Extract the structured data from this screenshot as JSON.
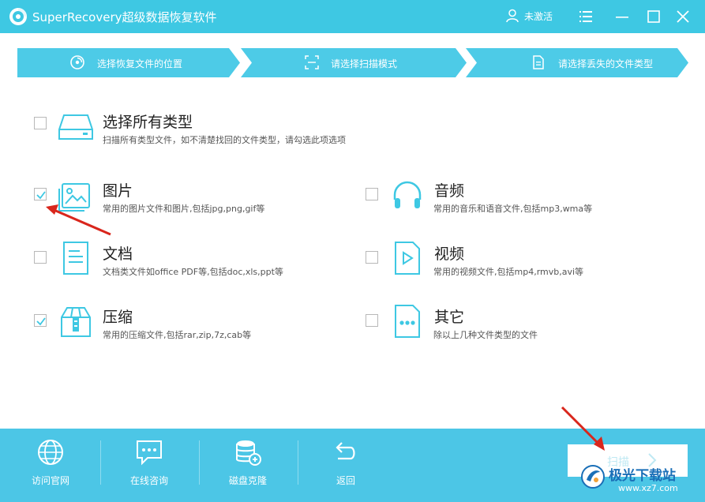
{
  "app": {
    "title": "SuperRecovery超级数据恢复软件",
    "user_label": "未激活",
    "accent": "#3ec8e3"
  },
  "steps": [
    {
      "label": "选择恢复文件的位置",
      "icon": "disc-icon"
    },
    {
      "label": "请选择扫描模式",
      "icon": "scan-frame-icon"
    },
    {
      "label": "请选择丢失的文件类型",
      "icon": "document-icon"
    }
  ],
  "options": {
    "all": {
      "title": "选择所有类型",
      "desc": "扫描所有类型文件，如不清楚找回的文件类型，请勾选此项选项",
      "checked": false
    },
    "images": {
      "title": "图片",
      "desc": "常用的图片文件和图片,包括jpg,png,gif等",
      "checked": true
    },
    "audio": {
      "title": "音频",
      "desc": "常用的音乐和语音文件,包括mp3,wma等",
      "checked": false
    },
    "documents": {
      "title": "文档",
      "desc": "文档类文件如office PDF等,包括doc,xls,ppt等",
      "checked": false
    },
    "video": {
      "title": "视频",
      "desc": "常用的视频文件,包括mp4,rmvb,avi等",
      "checked": false
    },
    "archives": {
      "title": "压缩",
      "desc": "常用的压缩文件,包括rar,zip,7z,cab等",
      "checked": true
    },
    "other": {
      "title": "其它",
      "desc": "除以上几种文件类型的文件",
      "checked": false
    }
  },
  "bottom": {
    "website": "访问官网",
    "consult": "在线咨询",
    "clone": "磁盘克隆",
    "back": "返回",
    "scan": "扫描"
  },
  "watermark": {
    "name": "极光下载站",
    "url": "www.xz7.com"
  }
}
